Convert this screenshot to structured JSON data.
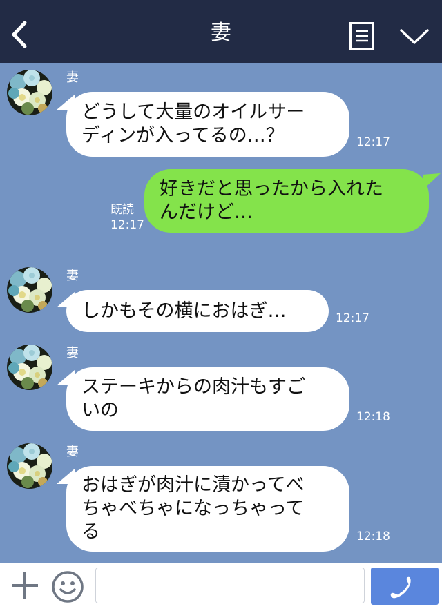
{
  "header": {
    "title": "妻",
    "back_icon": "chevron-left-icon",
    "menu_icon": "menu-icon",
    "expand_icon": "chevron-down-icon"
  },
  "messages": [
    {
      "sender": "妻",
      "text": "どうして大量のオイルサー\nディンが入ってるの…？",
      "time": "12:17"
    },
    {
      "read": "既読",
      "text": "好きだと思ったから入れた\nんだけど…",
      "time": "12:17"
    },
    {
      "sender": "妻",
      "text": "しかもその横におはぎ…",
      "time": "12:17"
    },
    {
      "sender": "妻",
      "text": "ステーキからの肉汁もすご\nいの",
      "time": "12:18"
    },
    {
      "sender": "妻",
      "text": "おはぎが肉汁に漬かってべ\nちゃべちゃになっちゃって\nる",
      "time": "12:18"
    }
  ],
  "input_bar": {
    "plus_icon": "plus-icon",
    "emoji_icon": "smiley-icon",
    "message_value": "",
    "call_icon": "phone-icon"
  },
  "colors": {
    "header_bg": "#222b45",
    "chat_bg": "#7494c3",
    "incoming_bubble": "#ffffff",
    "outgoing_bubble": "#84e34b",
    "call_button": "#5a86dd"
  }
}
